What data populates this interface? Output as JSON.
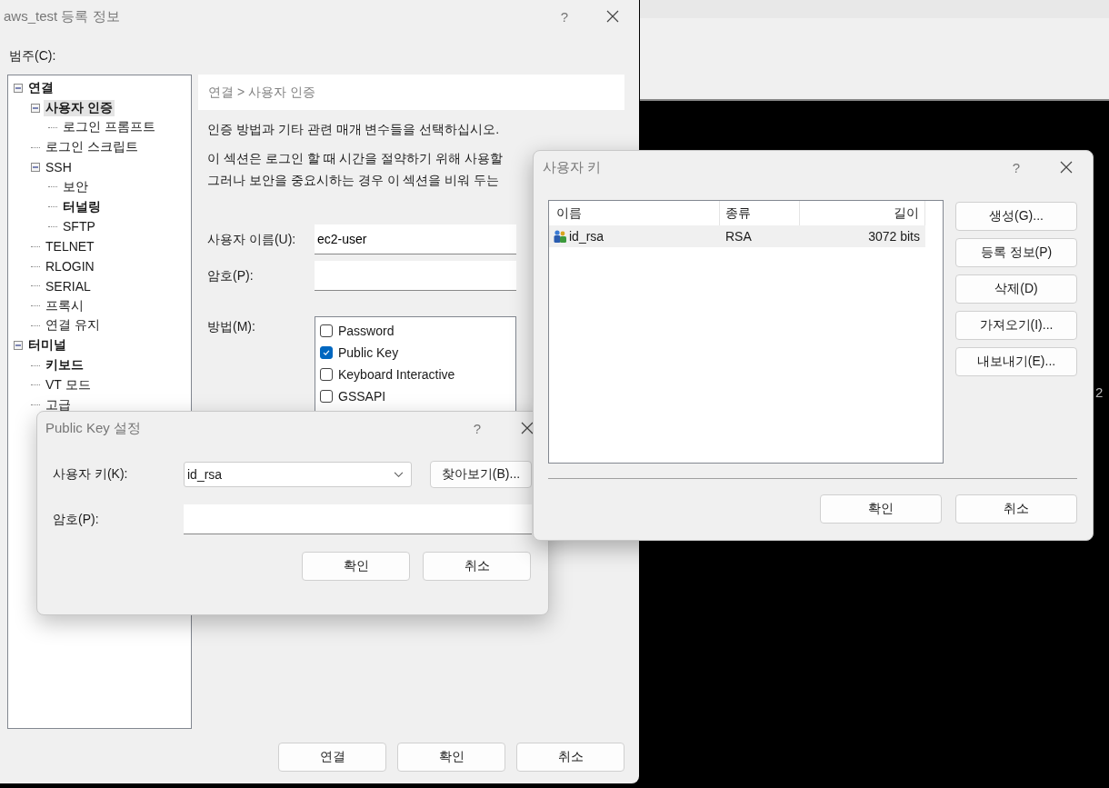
{
  "terminal": {
    "text": "2"
  },
  "main_window": {
    "title": "aws_test 등록 정보",
    "help": "?",
    "category_label": "범주(C):",
    "tree": [
      {
        "label": "연결",
        "bold": true,
        "selected": false,
        "expanded": true,
        "children": [
          {
            "label": "사용자 인증",
            "bold": true,
            "selected": true,
            "expanded": true,
            "children": [
              {
                "label": "로그인 프롬프트",
                "bold": false,
                "selected": false
              }
            ]
          },
          {
            "label": "로그인 스크립트",
            "bold": false,
            "selected": false
          },
          {
            "label": "SSH",
            "bold": false,
            "selected": false,
            "expanded": true,
            "children": [
              {
                "label": "보안",
                "bold": false,
                "selected": false
              },
              {
                "label": "터널링",
                "bold": true,
                "selected": false
              },
              {
                "label": "SFTP",
                "bold": false,
                "selected": false
              }
            ]
          },
          {
            "label": "TELNET",
            "bold": false,
            "selected": false
          },
          {
            "label": "RLOGIN",
            "bold": false,
            "selected": false
          },
          {
            "label": "SERIAL",
            "bold": false,
            "selected": false
          },
          {
            "label": "프록시",
            "bold": false,
            "selected": false
          },
          {
            "label": "연결 유지",
            "bold": false,
            "selected": false
          }
        ]
      },
      {
        "label": "터미널",
        "bold": true,
        "selected": false,
        "expanded": true,
        "children": [
          {
            "label": "키보드",
            "bold": true,
            "selected": false
          },
          {
            "label": "VT 모드",
            "bold": false,
            "selected": false
          },
          {
            "label": "고급",
            "bold": false,
            "selected": false
          }
        ]
      }
    ],
    "breadcrumb": "연결 > 사용자 인증",
    "intro": "인증 방법과 기타 관련 매개 변수들을 선택하십시오.",
    "description_lines": [
      "이 섹션은 로그인 할 때 시간을 절약하기 위해 사용할",
      "그러나 보안을 중요시하는 경우 이 섹션을 비워 두는"
    ],
    "username_label": "사용자 이름(U):",
    "username": "ec2-user",
    "password_label": "암호(P):",
    "method_label": "방법(M):",
    "methods": [
      {
        "label": "Password",
        "checked": false
      },
      {
        "label": "Public Key",
        "checked": true
      },
      {
        "label": "Keyboard Interactive",
        "checked": false
      },
      {
        "label": "GSSAPI",
        "checked": false
      }
    ],
    "buttons": [
      "연결",
      "확인",
      "취소"
    ]
  },
  "public_key_dialog": {
    "title": "Public Key 설정",
    "help": "?",
    "user_key_label": "사용자 키(K):",
    "user_key": "id_rsa",
    "browse_button": "찾아보기(B)...",
    "passphrase_label": "암호(P):",
    "buttons": [
      "확인",
      "취소"
    ]
  },
  "user_keys_dialog": {
    "title": "사용자 키",
    "help": "?",
    "columns": [
      "이름",
      "종류",
      "길이"
    ],
    "rows": [
      {
        "name": "id_rsa",
        "type": "RSA",
        "length": "3072 bits",
        "selected": true
      }
    ],
    "side_buttons": [
      "생성(G)...",
      "등록 정보(P)",
      "삭제(D)",
      "가져오기(I)...",
      "내보내기(E)..."
    ],
    "buttons": [
      "확인",
      "취소"
    ]
  }
}
